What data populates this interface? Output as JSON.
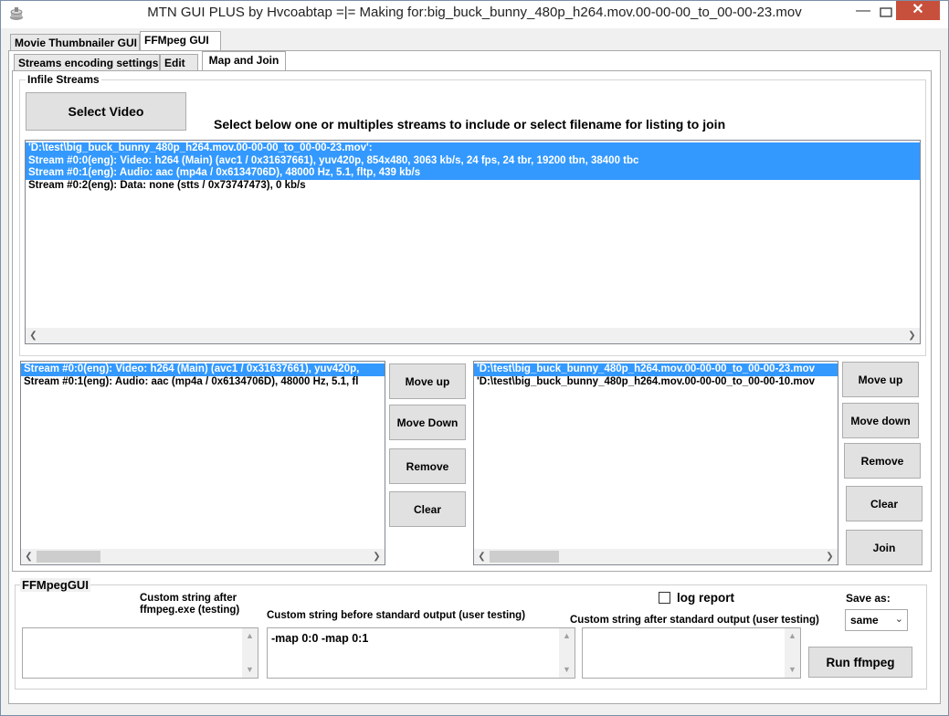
{
  "window": {
    "title": "MTN GUI PLUS by Hvcoabtap =|= Making for:big_buck_bunny_480p_h264.mov.00-00-00_to_00-00-23.mov",
    "close_glyph": "✕",
    "minimize_glyph": "—"
  },
  "top_tabs": [
    {
      "label": "Movie Thumbnailer GUI"
    },
    {
      "label": "FFMpeg GUI"
    }
  ],
  "sub_tabs": [
    {
      "label": "Streams encoding settings"
    },
    {
      "label": "Edit"
    },
    {
      "label": "Map and Join"
    }
  ],
  "infile": {
    "group_label": "Infile Streams",
    "select_video_label": "Select Video",
    "instruction": "Select below one or multiples streams to include or select filename for listing to join",
    "items": [
      {
        "text": "'D:\\test\\big_buck_bunny_480p_h264.mov.00-00-00_to_00-00-23.mov':",
        "selected": true
      },
      {
        "text": "Stream #0:0(eng): Video: h264 (Main) (avc1 / 0x31637661), yuv420p, 854x480, 3063 kb/s, 24 fps, 24 tbr, 19200 tbn, 38400 tbc",
        "selected": true
      },
      {
        "text": "Stream #0:1(eng): Audio: aac (mp4a / 0x6134706D), 48000 Hz, 5.1, fltp, 439 kb/s",
        "selected": true
      },
      {
        "text": "Stream #0:2(eng): Data: none (stts / 0x73747473), 0 kb/s",
        "selected": false
      }
    ]
  },
  "map_list": {
    "items": [
      {
        "text": "Stream #0:0(eng): Video: h264 (Main) (avc1 / 0x31637661), yuv420p,",
        "selected": true
      },
      {
        "text": "Stream #0:1(eng): Audio: aac (mp4a / 0x6134706D), 48000 Hz, 5.1, fl",
        "selected": false
      }
    ],
    "buttons": {
      "move_up": "Move up",
      "move_down": "Move Down",
      "remove": "Remove",
      "clear": "Clear"
    }
  },
  "join_list": {
    "items": [
      {
        "text": "'D:\\test\\big_buck_bunny_480p_h264.mov.00-00-00_to_00-00-23.mov",
        "selected": true
      },
      {
        "text": "'D:\\test\\big_buck_bunny_480p_h264.mov.00-00-00_to_00-00-10.mov",
        "selected": false
      }
    ],
    "buttons": {
      "move_up": "Move up",
      "move_down": "Move down",
      "remove": "Remove",
      "clear": "Clear",
      "join": "Join"
    }
  },
  "ffmpeg": {
    "group_label": "FFMpegGUI",
    "custom_after_exe_label": "Custom string after\nffmpeg.exe (testing)",
    "custom_after_exe_value": "",
    "custom_before_label": "Custom string before standard output (user testing)",
    "custom_before_value": "-map 0:0 -map 0:1",
    "custom_after_label": "Custom string after standard output (user testing)",
    "custom_after_value": "",
    "log_report_label": "log report",
    "log_report_checked": false,
    "save_as_label": "Save as:",
    "save_as_value": "same",
    "run_label": "Run ffmpeg"
  }
}
